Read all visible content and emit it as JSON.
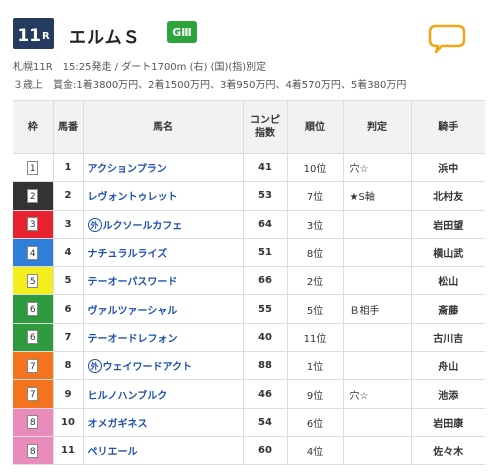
{
  "header": {
    "race_number": "11",
    "race_suffix": "R",
    "race_name": "エルムＳ",
    "grade": "GⅢ"
  },
  "info": {
    "line1": "札幌11R　15:25発走 / ダート1700m (右) (国)(指)別定",
    "line2": "３歳上　賞金:1着3800万円、2着1500万円、3着950万円、4着570万円、5着380万円"
  },
  "table": {
    "headers": {
      "waku": "枠",
      "umaban": "馬番",
      "horse": "馬名",
      "index": "コンピ\n指数",
      "rank": "順位",
      "judge": "判定",
      "jockey": "騎手"
    },
    "rows": [
      {
        "waku": "1",
        "waku_bg": "#ffffff",
        "waku_fg": "#333333",
        "umaban": "1",
        "foreign": "",
        "horse": "アクションプラン",
        "index": "41",
        "rank": "10位",
        "judge": "穴☆",
        "jockey": "浜中"
      },
      {
        "waku": "2",
        "waku_bg": "#333333",
        "waku_fg": "#ffffff",
        "umaban": "2",
        "foreign": "",
        "horse": "レヴォントゥレット",
        "index": "53",
        "rank": "7位",
        "judge": "★S軸",
        "jockey": "北村友"
      },
      {
        "waku": "3",
        "waku_bg": "#e8212f",
        "waku_fg": "#ffffff",
        "umaban": "3",
        "foreign": "外",
        "horse": "ルクソールカフェ",
        "index": "64",
        "rank": "3位",
        "judge": "",
        "jockey": "岩田望"
      },
      {
        "waku": "4",
        "waku_bg": "#2f7fd8",
        "waku_fg": "#ffffff",
        "umaban": "4",
        "foreign": "",
        "horse": "ナチュラルライズ",
        "index": "51",
        "rank": "8位",
        "judge": "",
        "jockey": "横山武"
      },
      {
        "waku": "5",
        "waku_bg": "#f5ee1e",
        "waku_fg": "#333333",
        "umaban": "5",
        "foreign": "",
        "horse": "テーオーパスワード",
        "index": "66",
        "rank": "2位",
        "judge": "",
        "jockey": "松山"
      },
      {
        "waku": "6",
        "waku_bg": "#2e9a3e",
        "waku_fg": "#ffffff",
        "umaban": "6",
        "foreign": "",
        "horse": "ヴァルツァーシャル",
        "index": "55",
        "rank": "5位",
        "judge": "Ｂ相手",
        "jockey": "斎藤"
      },
      {
        "waku": "6",
        "waku_bg": "#2e9a3e",
        "waku_fg": "#ffffff",
        "umaban": "7",
        "foreign": "",
        "horse": "テーオードレフォン",
        "index": "40",
        "rank": "11位",
        "judge": "",
        "jockey": "古川吉"
      },
      {
        "waku": "7",
        "waku_bg": "#f3731f",
        "waku_fg": "#ffffff",
        "umaban": "8",
        "foreign": "外",
        "horse": "ウェイワードアクト",
        "index": "88",
        "rank": "1位",
        "judge": "",
        "jockey": "舟山"
      },
      {
        "waku": "7",
        "waku_bg": "#f3731f",
        "waku_fg": "#ffffff",
        "umaban": "9",
        "foreign": "",
        "horse": "ヒルノハンブルク",
        "index": "46",
        "rank": "9位",
        "judge": "穴☆",
        "jockey": "池添"
      },
      {
        "waku": "8",
        "waku_bg": "#e98cbb",
        "waku_fg": "#333333",
        "umaban": "10",
        "foreign": "",
        "horse": "オメガギネス",
        "index": "54",
        "rank": "6位",
        "judge": "",
        "jockey": "岩田康"
      },
      {
        "waku": "8",
        "waku_bg": "#e98cbb",
        "waku_fg": "#333333",
        "umaban": "11",
        "foreign": "",
        "horse": "ペリエール",
        "index": "60",
        "rank": "4位",
        "judge": "",
        "jockey": "佐々木"
      }
    ]
  },
  "colors": {
    "race_badge": "#243a5e",
    "grade_badge": "#2fa43b",
    "horse_link": "#1d4fb5",
    "chat_icon": "#f2a516"
  },
  "icons": {
    "chat": "speech-bubble-icon"
  }
}
